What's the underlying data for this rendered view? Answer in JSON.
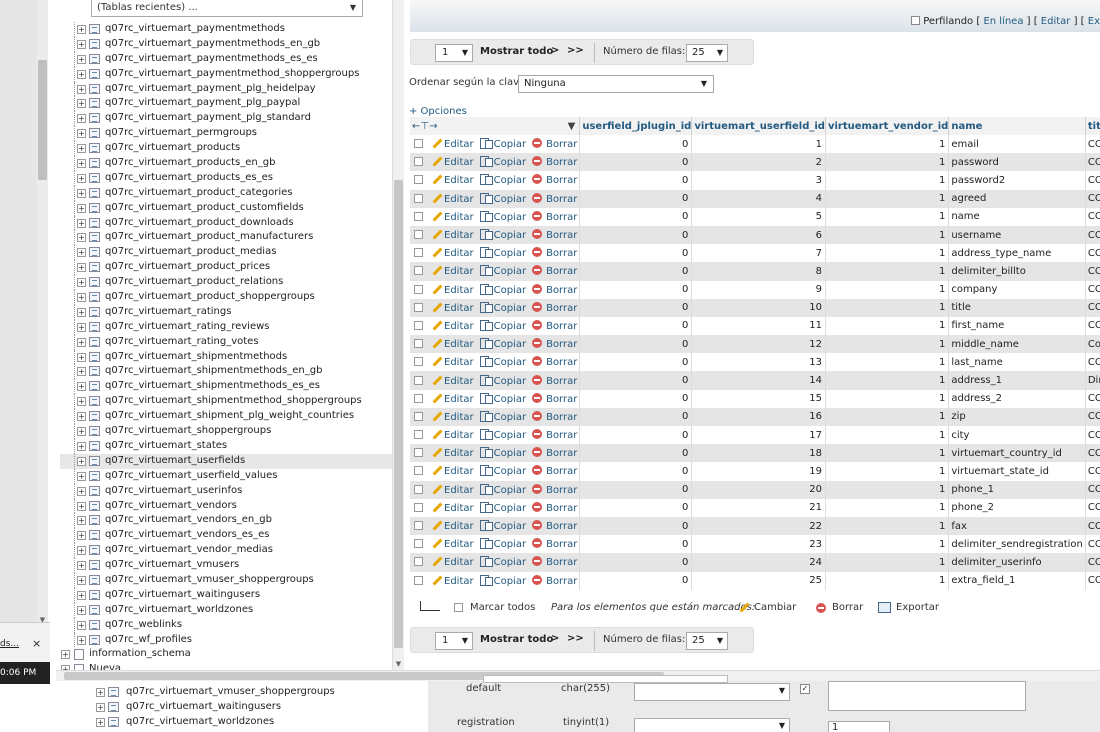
{
  "left": {
    "recent_tables": "(Tablas recientes) ...",
    "tree_items": [
      "q07rc_virtuemart_paymentmethods",
      "q07rc_virtuemart_paymentmethods_en_gb",
      "q07rc_virtuemart_paymentmethods_es_es",
      "q07rc_virtuemart_paymentmethod_shoppergroups",
      "q07rc_virtuemart_payment_plg_heidelpay",
      "q07rc_virtuemart_payment_plg_paypal",
      "q07rc_virtuemart_payment_plg_standard",
      "q07rc_virtuemart_permgroups",
      "q07rc_virtuemart_products",
      "q07rc_virtuemart_products_en_gb",
      "q07rc_virtuemart_products_es_es",
      "q07rc_virtuemart_product_categories",
      "q07rc_virtuemart_product_customfields",
      "q07rc_virtuemart_product_downloads",
      "q07rc_virtuemart_product_manufacturers",
      "q07rc_virtuemart_product_medias",
      "q07rc_virtuemart_product_prices",
      "q07rc_virtuemart_product_relations",
      "q07rc_virtuemart_product_shoppergroups",
      "q07rc_virtuemart_ratings",
      "q07rc_virtuemart_rating_reviews",
      "q07rc_virtuemart_rating_votes",
      "q07rc_virtuemart_shipmentmethods",
      "q07rc_virtuemart_shipmentmethods_en_gb",
      "q07rc_virtuemart_shipmentmethods_es_es",
      "q07rc_virtuemart_shipmentmethod_shoppergroups",
      "q07rc_virtuemart_shipment_plg_weight_countries",
      "q07rc_virtuemart_shoppergroups",
      "q07rc_virtuemart_states",
      "q07rc_virtuemart_userfields",
      "q07rc_virtuemart_userfield_values",
      "q07rc_virtuemart_userinfos",
      "q07rc_virtuemart_vendors",
      "q07rc_virtuemart_vendors_en_gb",
      "q07rc_virtuemart_vendors_es_es",
      "q07rc_virtuemart_vendor_medias",
      "q07rc_virtuemart_vmusers",
      "q07rc_virtuemart_vmuser_shoppergroups",
      "q07rc_virtuemart_waitingusers",
      "q07rc_virtuemart_worldzones",
      "q07rc_weblinks",
      "q07rc_wf_profiles"
    ],
    "selected_index": 29,
    "db_items": [
      "information_schema",
      "Nueva"
    ]
  },
  "notif": {
    "text": "ds...",
    "close": "×",
    "clock": "0:06 PM"
  },
  "header": {
    "profiling_label": "Perfilando",
    "links": [
      "En línea",
      "Editar",
      "Ex"
    ]
  },
  "nav": {
    "page": "1",
    "show_all": "Mostrar todo",
    "next": ">",
    "last": ">>",
    "rows_label": "Número de filas:",
    "rows": "25"
  },
  "order": {
    "label": "Ordenar según la clave:",
    "value": "Ninguna"
  },
  "options_link": "+ Opciones",
  "table": {
    "columns": [
      "userfield_jplugin_id",
      "virtuemart_userfield_id",
      "virtuemart_vendor_id",
      "name",
      "title"
    ],
    "actions": {
      "edit": "Editar",
      "copy": "Copiar",
      "delete": "Borrar"
    },
    "rows": [
      {
        "jplugin": "0",
        "id": "1",
        "vendor": "1",
        "name": "email",
        "title": "COM_VIRTUEMA"
      },
      {
        "jplugin": "0",
        "id": "2",
        "vendor": "1",
        "name": "password",
        "title": "COM_VIRTUEMA"
      },
      {
        "jplugin": "0",
        "id": "3",
        "vendor": "1",
        "name": "password2",
        "title": "COM_VIRTUEMA"
      },
      {
        "jplugin": "0",
        "id": "4",
        "vendor": "1",
        "name": "agreed",
        "title": "COM_VIRTUEMA"
      },
      {
        "jplugin": "0",
        "id": "5",
        "vendor": "1",
        "name": "name",
        "title": "COM_VIRTUEMA"
      },
      {
        "jplugin": "0",
        "id": "6",
        "vendor": "1",
        "name": "username",
        "title": "COM_VIRTUEMA"
      },
      {
        "jplugin": "0",
        "id": "7",
        "vendor": "1",
        "name": "address_type_name",
        "title": "COM_VIRTUEMA"
      },
      {
        "jplugin": "0",
        "id": "8",
        "vendor": "1",
        "name": "delimiter_billto",
        "title": "COM_VIRTUEMA"
      },
      {
        "jplugin": "0",
        "id": "9",
        "vendor": "1",
        "name": "company",
        "title": "COM_VIRTUEMA"
      },
      {
        "jplugin": "0",
        "id": "10",
        "vendor": "1",
        "name": "title",
        "title": "COM_VIRTUEMA"
      },
      {
        "jplugin": "0",
        "id": "11",
        "vendor": "1",
        "name": "first_name",
        "title": "COM_VIRTUEMA"
      },
      {
        "jplugin": "0",
        "id": "12",
        "vendor": "1",
        "name": "middle_name",
        "title": "Comuna"
      },
      {
        "jplugin": "0",
        "id": "13",
        "vendor": "1",
        "name": "last_name",
        "title": "COM_VIRTUEMA"
      },
      {
        "jplugin": "0",
        "id": "14",
        "vendor": "1",
        "name": "address_1",
        "title": "Dirección"
      },
      {
        "jplugin": "0",
        "id": "15",
        "vendor": "1",
        "name": "address_2",
        "title": "COM_VIRTUEMA"
      },
      {
        "jplugin": "0",
        "id": "16",
        "vendor": "1",
        "name": "zip",
        "title": "COM_VIRTUEMA"
      },
      {
        "jplugin": "0",
        "id": "17",
        "vendor": "1",
        "name": "city",
        "title": "COM_VIRTUEMA"
      },
      {
        "jplugin": "0",
        "id": "18",
        "vendor": "1",
        "name": "virtuemart_country_id",
        "title": "COM_VIRTUEMA"
      },
      {
        "jplugin": "0",
        "id": "19",
        "vendor": "1",
        "name": "virtuemart_state_id",
        "title": "COM_VIRTUEMA"
      },
      {
        "jplugin": "0",
        "id": "20",
        "vendor": "1",
        "name": "phone_1",
        "title": "COM_VIRTUEMA"
      },
      {
        "jplugin": "0",
        "id": "21",
        "vendor": "1",
        "name": "phone_2",
        "title": "COM_VIRTUEMA"
      },
      {
        "jplugin": "0",
        "id": "22",
        "vendor": "1",
        "name": "fax",
        "title": "COM_VIRTUEMA"
      },
      {
        "jplugin": "0",
        "id": "23",
        "vendor": "1",
        "name": "delimiter_sendregistration",
        "title": "COM_VIRTUEMA"
      },
      {
        "jplugin": "0",
        "id": "24",
        "vendor": "1",
        "name": "delimiter_userinfo",
        "title": "COM_VIRTUEMA"
      },
      {
        "jplugin": "0",
        "id": "25",
        "vendor": "1",
        "name": "extra_field_1",
        "title": "COM_VIRTUEMA"
      }
    ]
  },
  "bulk": {
    "select_all": "Marcar todos",
    "for_selected": "Para los elementos que están marcados:",
    "change": "Cambiar",
    "delete": "Borrar",
    "export": "Exportar"
  },
  "bottom": {
    "tree_items": [
      "q07rc_virtuemart_vmuser_shoppergroups",
      "q07rc_virtuemart_waitingusers",
      "q07rc_virtuemart_worldzones"
    ],
    "fields": [
      {
        "name": "default",
        "type": "char(255)"
      },
      {
        "name": "registration",
        "type": "tinyint(1)"
      }
    ],
    "registration_value": "1"
  },
  "colors": {
    "link": "#235a81",
    "row_alt": "#e5e5e5",
    "delete": "#d9534f",
    "edit": "#e6a700"
  }
}
